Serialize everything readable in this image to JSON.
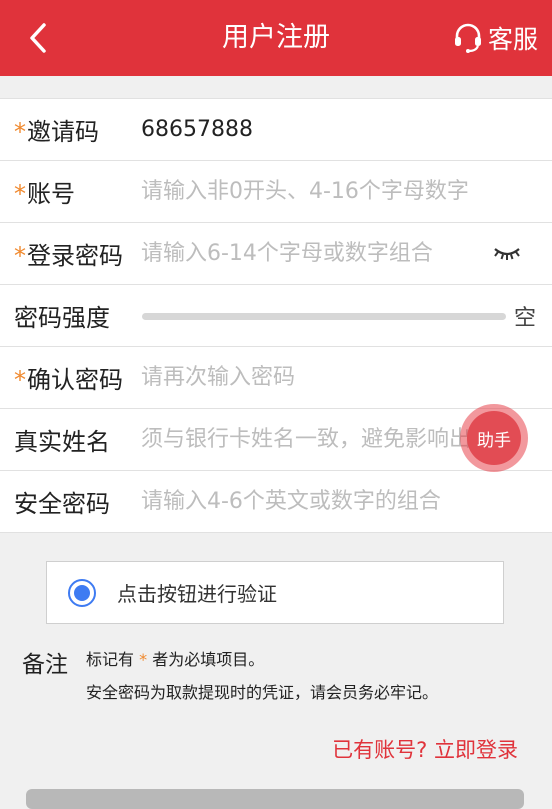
{
  "header": {
    "title": "用户注册",
    "service_label": "客服",
    "back_icon": "chevron-left-icon",
    "service_icon": "headset-icon",
    "color": "#e0333b"
  },
  "form": {
    "invite": {
      "label": "邀请码",
      "value": "68657888",
      "required": true
    },
    "account": {
      "label": "账号",
      "placeholder": "请输入非0开头、4-16个字母数字",
      "required": true
    },
    "password": {
      "label": "登录密码",
      "placeholder": "请输入6-14个字母或数字组合",
      "required": true,
      "toggle_icon": "eye-closed-icon"
    },
    "strength": {
      "label": "密码强度",
      "level_text": "空",
      "level": 0
    },
    "confirm": {
      "label": "确认密码",
      "placeholder": "请再次输入密码",
      "required": true
    },
    "realname": {
      "label": "真实姓名",
      "placeholder": "须与银行卡姓名一致，避免影响出款"
    },
    "safe": {
      "label": "安全密码",
      "placeholder": "请输入4-6个英文或数字的组合"
    }
  },
  "required_mark": "*",
  "helper": {
    "label": "助手"
  },
  "verify": {
    "label": "点击按钮进行验证",
    "accent": "#3e7bf2"
  },
  "note": {
    "label": "备注",
    "line1_prefix": "标记有",
    "line1_star": "*",
    "line1_suffix": "者为必填项目。",
    "line2": "安全密码为取款提现时的凭证，请会员务必牢记。"
  },
  "login_link": "已有账号? 立即登录"
}
